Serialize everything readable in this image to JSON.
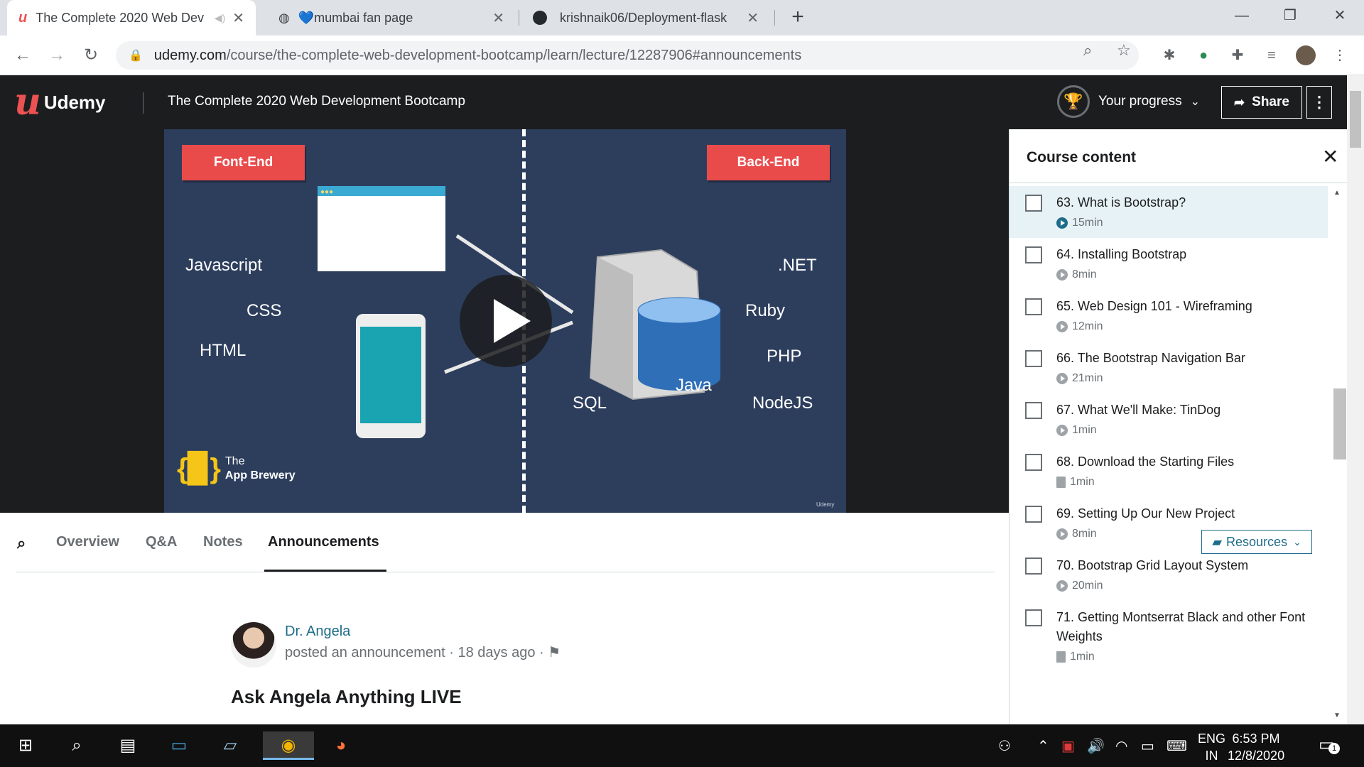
{
  "browser": {
    "tabs": [
      {
        "title": "The Complete 2020 Web Dev",
        "icon": "udemy-favicon"
      },
      {
        "title": "💙mumbai fan page",
        "icon": "globe-icon"
      },
      {
        "title": "krishnaik06/Deployment-flask",
        "icon": "github-icon"
      }
    ],
    "url_host": "udemy.com",
    "url_path": "/course/the-complete-web-development-bootcamp/learn/lecture/12287906#announcements"
  },
  "header": {
    "logo_text": "Udemy",
    "course_title": "The Complete 2020 Web Development Bootcamp",
    "progress_label": "Your progress",
    "share_label": "Share"
  },
  "slide": {
    "frontend_label": "Font-End",
    "backend_label": "Back-End",
    "front_techs": [
      "Javascript",
      "CSS",
      "HTML"
    ],
    "back_techs": [
      ".NET",
      "Ruby",
      "PHP",
      "Java",
      "SQL",
      "NodeJS"
    ],
    "brand_line1": "The",
    "brand_line2": "App Brewery",
    "watermark": "Udemy"
  },
  "nav": {
    "tabs": [
      "Overview",
      "Q&A",
      "Notes",
      "Announcements"
    ],
    "active": "Announcements"
  },
  "announcement": {
    "author": "Dr. Angela",
    "meta": "posted an announcement · 18 days ago ·",
    "title": "Ask Angela Anything LIVE"
  },
  "sidebar": {
    "title": "Course content",
    "resources_label": "Resources",
    "lessons": [
      {
        "name": "63. What is Bootstrap?",
        "duration": "15min",
        "type": "video",
        "current": true
      },
      {
        "name": "64. Installing Bootstrap",
        "duration": "8min",
        "type": "video"
      },
      {
        "name": "65. Web Design 101 - Wireframing",
        "duration": "12min",
        "type": "video"
      },
      {
        "name": "66. The Bootstrap Navigation Bar",
        "duration": "21min",
        "type": "video"
      },
      {
        "name": "67. What We'll Make: TinDog",
        "duration": "1min",
        "type": "video"
      },
      {
        "name": "68. Download the Starting Files",
        "duration": "1min",
        "type": "article"
      },
      {
        "name": "69. Setting Up Our New Project",
        "duration": "8min",
        "type": "video",
        "resources": true
      },
      {
        "name": "70. Bootstrap Grid Layout System",
        "duration": "20min",
        "type": "video"
      },
      {
        "name": "71. Getting Montserrat Black and other Font Weights",
        "duration": "1min",
        "type": "article"
      }
    ]
  },
  "taskbar": {
    "lang1": "ENG",
    "lang2": "IN",
    "time": "6:53 PM",
    "date": "12/8/2020",
    "notifications": "1"
  },
  "colors": {
    "udemy_red": "#ec5252",
    "header_bg": "#1c1d1f",
    "slide_bg": "#2d3e5d",
    "link_blue": "#1e6c8a"
  }
}
